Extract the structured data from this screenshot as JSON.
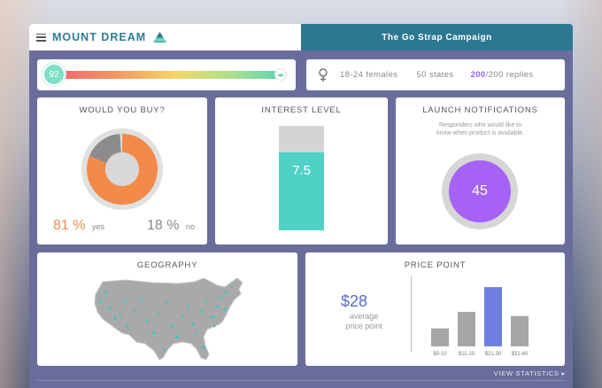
{
  "brand": {
    "name": "MOUNT DREAM"
  },
  "campaign": {
    "title": "The Go Strap Campaign"
  },
  "score": {
    "value": "92",
    "fraction": 0.92
  },
  "demographics": {
    "age_group": "18-24 females",
    "states": "50 states",
    "replies_count": "200",
    "replies_total": "/200 replies"
  },
  "would_you_buy": {
    "title": "WOULD YOU BUY?",
    "yes_value": "81",
    "yes_unit": "%",
    "yes_label": "yes",
    "no_value": "18",
    "no_unit": "%",
    "no_label": "no",
    "yes_fraction": 0.81,
    "no_fraction": 0.18
  },
  "interest": {
    "title": "INTEREST LEVEL",
    "value": "7.5",
    "max": 10
  },
  "launch": {
    "title": "LAUNCH NOTIFICATIONS",
    "subtitle_line1": "Responders who would like to",
    "subtitle_line2": "know when product is available.",
    "count": "45"
  },
  "geography": {
    "title": "GEOGRAPHY"
  },
  "price_point": {
    "title": "PRICE POINT",
    "average_value": "$28",
    "average_label_line1": "average",
    "average_label_line2": "price point"
  },
  "footer": {
    "link_label": "VIEW STATISTICS ▸"
  },
  "colors": {
    "accent_teal": "#2c7791",
    "orange": "#f28a4a",
    "purple": "#a662f5",
    "mint": "#4fd1c5",
    "bar_gray": "#a6a6a6",
    "bar_highlight": "#6f7ee0"
  },
  "chart_data": {
    "type": "bar",
    "categories": [
      "$0-10",
      "$11-20",
      "$21-30",
      "$31-40"
    ],
    "values": [
      13,
      25,
      43,
      22
    ],
    "highlight_index": 2,
    "ylim": [
      0,
      45
    ]
  }
}
